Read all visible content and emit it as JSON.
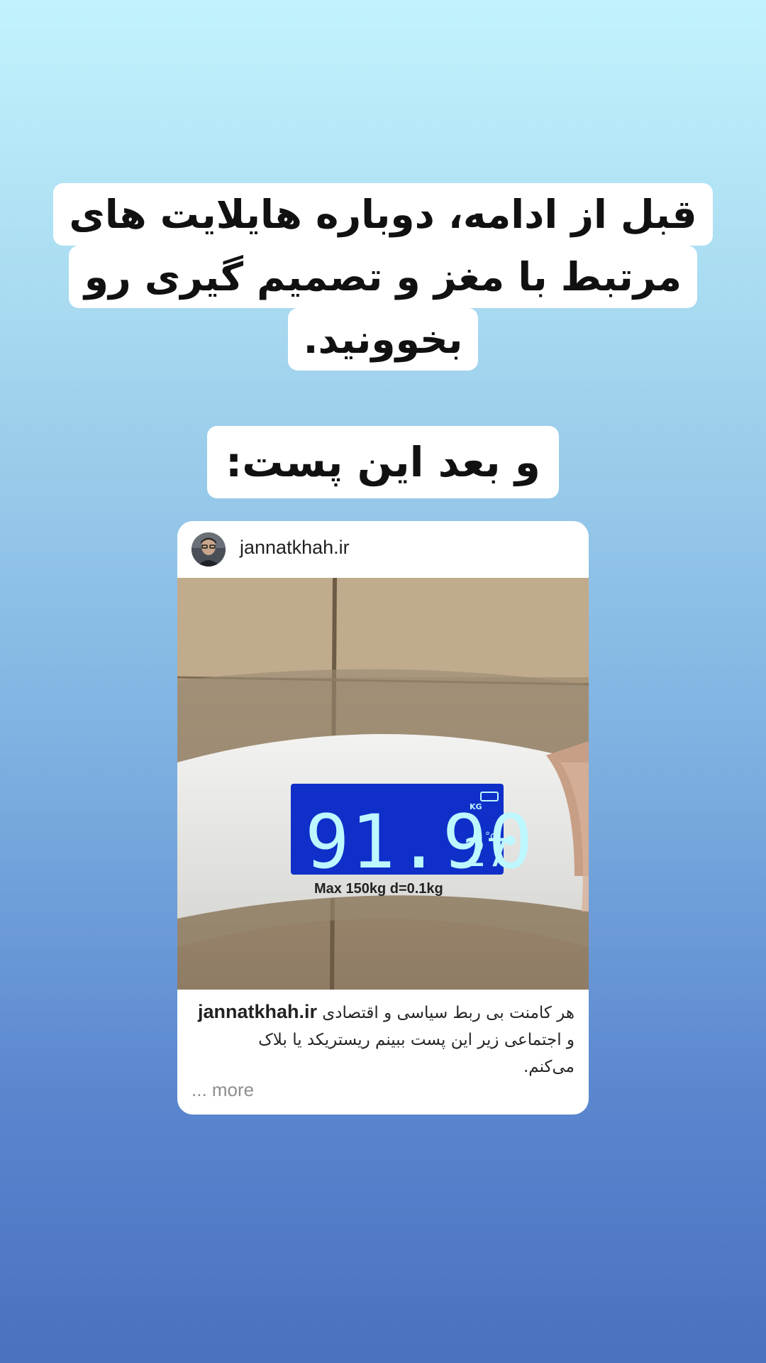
{
  "headline": {
    "lines": [
      "قبل از ادامه، دوباره هایلایت های",
      "مرتبط با مغز و تصمیم گیری رو",
      "بخوونید."
    ]
  },
  "subhead": {
    "text": "و بعد این پست:"
  },
  "post": {
    "username": "jannatkhah.ir",
    "avatar_icon": "person-photo-icon",
    "photo": {
      "description_icon": "bathroom-scale-icon",
      "display_digits": "91.90",
      "unit": "KG",
      "temperature": "27",
      "temperature_unit": "°c",
      "spec_text": "Max 150kg d=0.1kg",
      "display_color": "#0f2fc8",
      "digit_color": "#bdf7ff"
    },
    "caption": {
      "username": "jannatkhah.ir",
      "line1": "هر کامنت بی ربط سیاسی و اقتصادی",
      "line2": "و اجتماعی زیر این پست ببینم ریستریکد یا بلاک",
      "line3": "می‌کنم."
    },
    "more_label": "... more"
  }
}
